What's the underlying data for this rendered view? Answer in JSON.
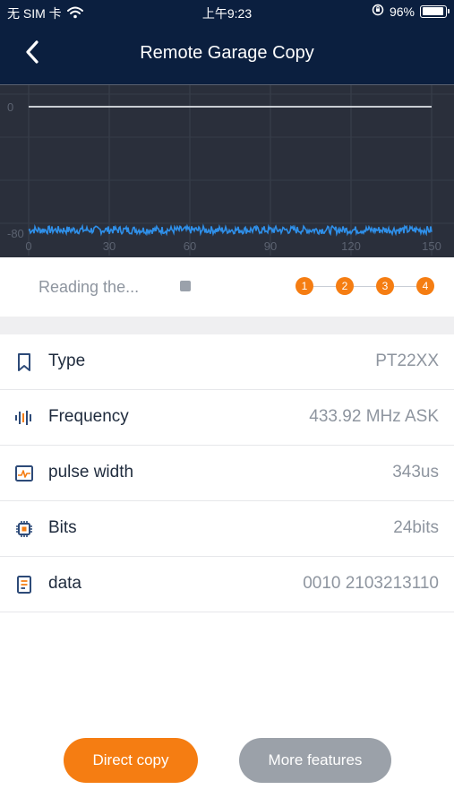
{
  "status_bar": {
    "carrier": "无 SIM 卡",
    "time": "上午9:23",
    "battery_text": "96%",
    "battery_level": 0.96
  },
  "nav": {
    "title": "Remote Garage Copy"
  },
  "chart_data": {
    "type": "line",
    "x_ticks": [
      "0",
      "30",
      "60",
      "90",
      "120",
      "150"
    ],
    "y_ticks": [
      "0",
      "-80"
    ],
    "xlim": [
      0,
      150
    ],
    "ylim": [
      -80,
      0
    ],
    "series": [
      {
        "values_description_free": true,
        "y": 0,
        "x_range": [
          0,
          150
        ],
        "color": "#c8ccd2"
      },
      {
        "y_mean": -78,
        "x_range": [
          0,
          150
        ],
        "color": "#2f8fe8"
      }
    ],
    "grid": true
  },
  "progress": {
    "reading_text": "Reading the...",
    "steps": [
      "1",
      "2",
      "3",
      "4"
    ],
    "accent": "#f57d12"
  },
  "info": {
    "rows": [
      {
        "icon": "bookmark-icon",
        "label": "Type",
        "value": "PT22XX"
      },
      {
        "icon": "frequency-icon",
        "label": "Frequency",
        "value": "433.92 MHz ASK"
      },
      {
        "icon": "pulse-icon",
        "label": "pulse width",
        "value": "343us"
      },
      {
        "icon": "chip-icon",
        "label": "Bits",
        "value": "24bits"
      },
      {
        "icon": "document-icon",
        "label": "data",
        "value": "0010 2103213110"
      }
    ]
  },
  "actions": {
    "direct_copy": "Direct copy",
    "more_features": "More features"
  }
}
